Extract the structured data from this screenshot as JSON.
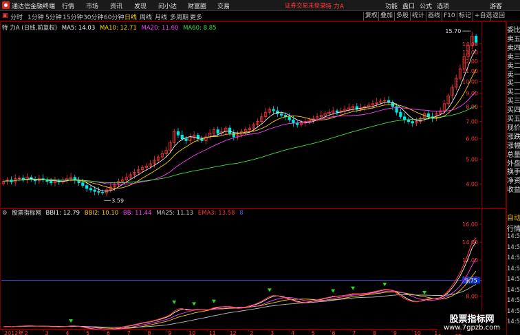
{
  "app": {
    "title": "通达信金融终端",
    "login_status": "证券交易未登录",
    "stock_name": "特 力A",
    "guest": "游客"
  },
  "menu": [
    "行情",
    "市场",
    "资讯",
    "发现",
    "问小达",
    "财富圈",
    "交易"
  ],
  "right_menu": [
    "功能",
    "盘口",
    "公式",
    "选项"
  ],
  "periods": {
    "items": [
      "分时",
      "1分钟",
      "5分钟",
      "15分钟",
      "30分钟",
      "60分钟",
      "日线",
      "周线",
      "月线",
      "多周期",
      "更多"
    ],
    "active": "日线",
    "left_box": "▣"
  },
  "toolbar": [
    "复权",
    "叠加",
    "多股",
    "统计",
    "画线",
    "F10",
    "标记",
    "+自选",
    "返回"
  ],
  "main_legend": {
    "title": "特 力A (日线,前复权)",
    "items": [
      {
        "label": "MA5: 14.03",
        "color": "#f0f0f0"
      },
      {
        "label": "MA10: 12.71",
        "color": "#ffd200"
      },
      {
        "label": "MA20: 11.60",
        "color": "#ff40ff"
      },
      {
        "label": "MA60: 8.85",
        "color": "#40e040"
      }
    ]
  },
  "ind_legend": {
    "title": "股票指标网",
    "items": [
      {
        "label": "BBI1: 12.79",
        "color": "#f0f0f0"
      },
      {
        "label": "BBI2: 10.10",
        "color": "#ffd200"
      },
      {
        "label": "BB: 11.44",
        "color": "#ff40ff"
      },
      {
        "label": "MA25: 11.13",
        "color": "#c0c0c0"
      },
      {
        "label": "EMA3: 13.58",
        "color": "#ff3333"
      },
      {
        "label": "8",
        "color": "#4060ff"
      }
    ]
  },
  "side_panel": {
    "labels": [
      "委比",
      "卖五",
      "卖四",
      "卖三",
      "卖二",
      "卖一",
      "买一",
      "买二",
      "买三",
      "买四",
      "买五",
      "现价",
      "涨跌",
      "涨幅",
      "总量",
      "外盘",
      "换手",
      "净资",
      "收益"
    ],
    "lower_labels": [
      "自动",
      "行情",
      "14:56",
      "14:56",
      "14:56",
      "14:56",
      "14:56",
      "14:56",
      "14:56",
      "14:56",
      "14:56"
    ]
  },
  "watermark": {
    "line1": "股票指标网",
    "line2": "www.7gpzb.com"
  },
  "chart_data": {
    "type": "candlestick",
    "main": {
      "title": "特 力A (日线,前复权)",
      "yticks": [
        4.0,
        5.0,
        6.0,
        7.0,
        8.0,
        9.0,
        10.0,
        11.0,
        12.0,
        13.0,
        14.0
      ],
      "ylim": [
        3.3,
        16.1
      ],
      "scale": "log",
      "high_label": "15.70",
      "low_label": "3.59",
      "closes": [
        4.1,
        4.15,
        4.08,
        4.2,
        4.22,
        4.15,
        4.25,
        4.18,
        4.12,
        4.2,
        4.15,
        4.1,
        4.05,
        4.12,
        4.08,
        4.15,
        4.2,
        4.25,
        4.15,
        4.05,
        3.95,
        3.85,
        3.8,
        3.75,
        3.72,
        3.7,
        3.8,
        3.9,
        4.0,
        4.1,
        4.15,
        4.25,
        4.35,
        4.45,
        4.55,
        4.65,
        4.7,
        4.8,
        4.95,
        5.1,
        5.25,
        5.4,
        5.8,
        6.4,
        6.2,
        6.0,
        5.9,
        6.1,
        6.2,
        6.0,
        5.9,
        6.1,
        6.3,
        6.5,
        6.3,
        6.4,
        6.6,
        6.3,
        6.1,
        6.2,
        6.4,
        6.5,
        6.6,
        6.8,
        7.0,
        7.3,
        7.6,
        7.8,
        7.7,
        7.5,
        7.4,
        7.3,
        7.1,
        6.9,
        6.8,
        6.9,
        7.0,
        7.1,
        7.2,
        7.3,
        7.4,
        7.5,
        7.6,
        7.7,
        7.6,
        7.7,
        7.8,
        7.9,
        8.0,
        7.8,
        7.9,
        8.0,
        8.1,
        8.2,
        8.3,
        8.4,
        8.45,
        8.3,
        8.0,
        7.6,
        7.3,
        7.1,
        7.0,
        6.9,
        7.0,
        7.2,
        7.5,
        7.3,
        7.2,
        7.5,
        7.7,
        8.2,
        8.8,
        9.5,
        10.3,
        11.2,
        12.5,
        13.8,
        15.0,
        14.2
      ],
      "series": [
        {
          "name": "MA5",
          "color": "#f0f0f0"
        },
        {
          "name": "MA10",
          "color": "#ffd200"
        },
        {
          "name": "MA20",
          "color": "#ff40ff"
        },
        {
          "name": "MA60",
          "color": "#40e040"
        }
      ]
    },
    "indicator": {
      "title": "股票指标网",
      "yticks": [
        6.0,
        8.0,
        10.0,
        12.0,
        14.0,
        16.0
      ],
      "ylim": [
        4.5,
        17.0
      ],
      "current_value": "9.75",
      "series": [
        {
          "name": "BBI1",
          "color": "#f0f0f0"
        },
        {
          "name": "BBI2",
          "color": "#ffd200"
        },
        {
          "name": "BB",
          "color": "#ff40ff"
        },
        {
          "name": "MA25",
          "color": "#c0c0c0"
        },
        {
          "name": "EMA3",
          "color": "#ff3333"
        }
      ]
    },
    "xaxis": {
      "labels": [
        "2012年",
        "2",
        "3",
        "4",
        "5",
        "6",
        "7",
        "8",
        "9",
        "10",
        "11",
        "12",
        "2",
        "3",
        "4",
        "5",
        "6",
        "7",
        "8",
        "9",
        "10",
        "11",
        "12"
      ]
    }
  }
}
